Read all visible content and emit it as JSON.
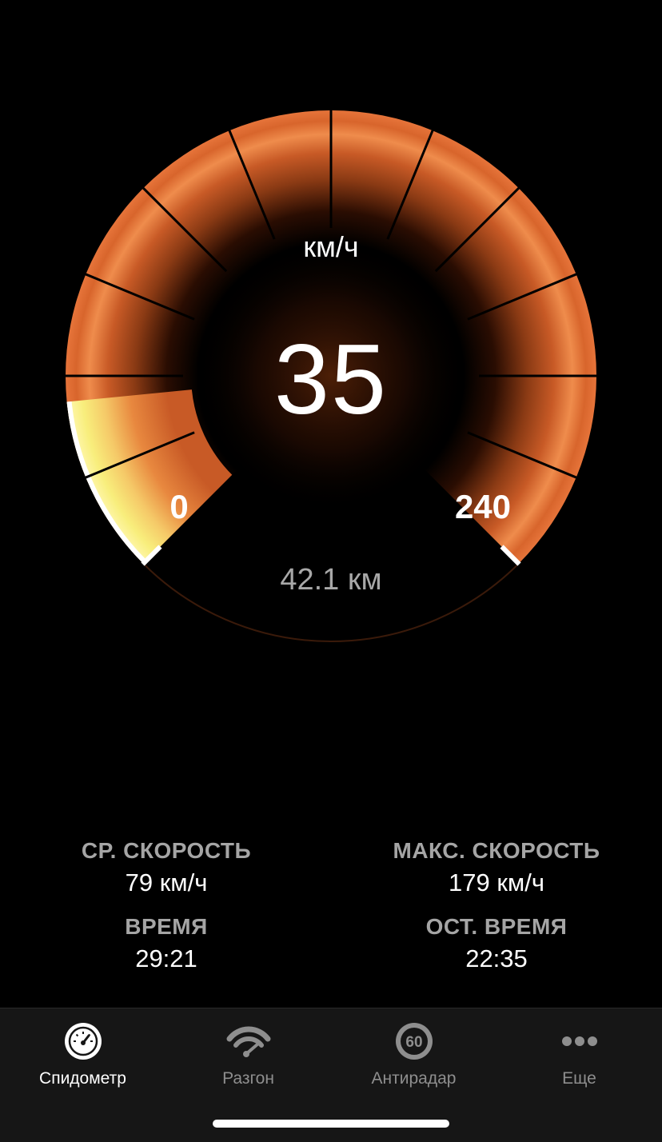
{
  "speedometer": {
    "unit": "км/ч",
    "speed": "35",
    "speed_value": 35,
    "min_label": "0",
    "max_label": "240",
    "min_value": 0,
    "max_value": 240,
    "distance": "42.1 км",
    "colors": {
      "arc": "#e8773a",
      "arc_inner": "#c35524",
      "active_fill": "#f4e36b",
      "background": "#000000"
    }
  },
  "stats": {
    "avg_speed": {
      "label": "СР. СКОРОСТЬ",
      "value": "79 км/ч"
    },
    "max_speed": {
      "label": "МАКС. СКОРОСТЬ",
      "value": "179 км/ч"
    },
    "time": {
      "label": "ВРЕМЯ",
      "value": "29:21"
    },
    "remaining_time": {
      "label": "ОСТ. ВРЕМЯ",
      "value": "22:35"
    }
  },
  "tabbar": {
    "tabs": [
      {
        "label": "Спидометр",
        "icon": "speedometer-icon",
        "active": true
      },
      {
        "label": "Разгон",
        "icon": "acceleration-icon",
        "active": false
      },
      {
        "label": "Антирадар",
        "icon": "speed-limit-icon",
        "active": false,
        "badge": "60"
      },
      {
        "label": "Еще",
        "icon": "more-icon",
        "active": false
      }
    ]
  }
}
